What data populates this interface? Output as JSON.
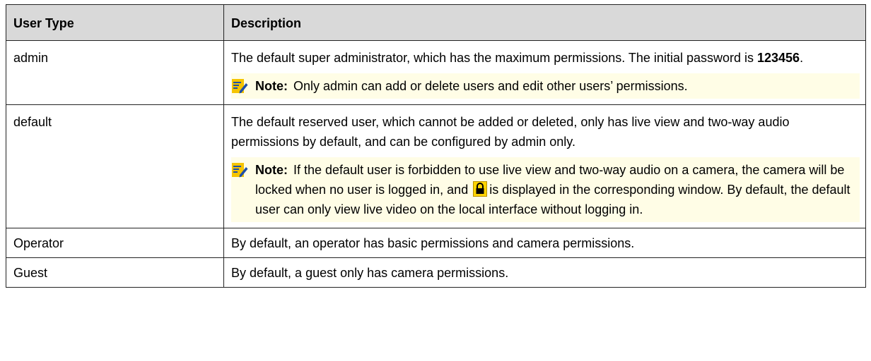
{
  "table": {
    "headers": [
      "User Type",
      "Description"
    ],
    "rows": [
      {
        "type": "admin",
        "desc_prefix": "The default super administrator, which has the maximum permissions. The initial password is ",
        "desc_bold": "123456",
        "desc_suffix": ".",
        "note_label": "Note:",
        "note_text": "Only admin can add or delete users and edit other users’ permissions."
      },
      {
        "type": "default",
        "desc": "The default reserved user, which cannot be added or deleted, only has live view and two-way audio permissions by default, and can be configured by admin only.",
        "note_label": "Note:",
        "note_text_before_icon": "If the default user is forbidden to use live view and two-way audio on a camera, the camera will be locked when no user is logged in, and ",
        "note_text_after_icon": "is displayed in the corresponding window. By default, the default user can only view live video on the local interface without logging in."
      },
      {
        "type": "Operator",
        "desc": "By default, an operator has basic permissions and camera permissions."
      },
      {
        "type": "Guest",
        "desc": "By default, a guest only has camera permissions."
      }
    ]
  },
  "icons": {
    "note": "note-pencil-icon",
    "lock": "lock-icon"
  },
  "colors": {
    "header_bg": "#d9d9d9",
    "note_bg": "#fffde6",
    "note_icon_blue": "#1f4fa8",
    "note_icon_yellow": "#f5c400",
    "lock_yellow": "#ffd400"
  }
}
